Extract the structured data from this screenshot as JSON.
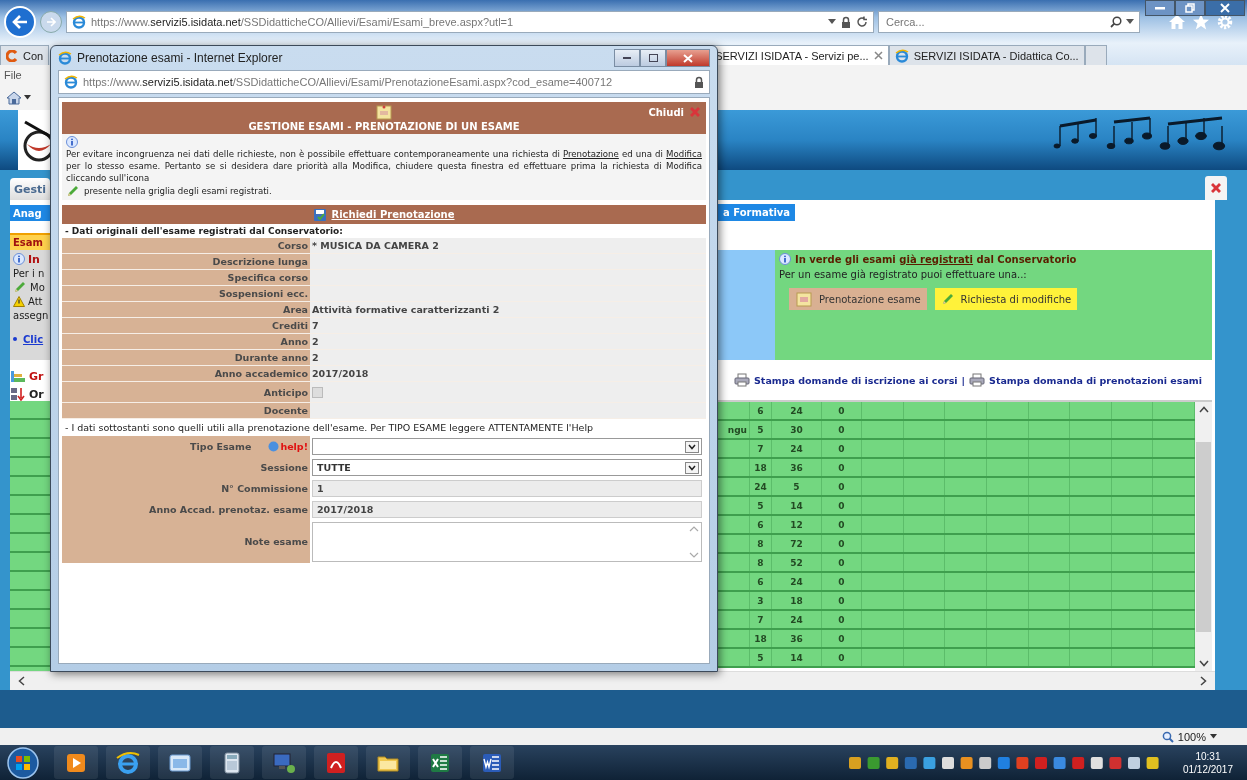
{
  "browser": {
    "address": "https://www.**servizi5.isidata.net**/SSDidatticheCO/Allievi/Esami/Esami_breve.aspx?utl=1",
    "search": {
      "placeholder": "Cerca..."
    },
    "tabs": [
      {
        "label": "Con",
        "selected": false
      },
      {
        "label": "SERVIZI ISIDATA - Servizi pe...",
        "selected": true
      },
      {
        "label": "SERVIZI ISIDATA - Didattica Co...",
        "selected": false
      }
    ],
    "menu": [
      "File"
    ]
  },
  "page": {
    "section_tab": "Gesti",
    "left": {
      "tab": "Anag",
      "exam_tab": "Esam",
      "notice": [
        {
          "kind": "info",
          "text": "In"
        },
        {
          "kind": "plain",
          "text": "Per i n"
        },
        {
          "kind": "pencil",
          "text": "Mo"
        },
        {
          "kind": "warning",
          "text": "Att"
        },
        {
          "kind": "plain",
          "text": "assegn"
        },
        {
          "kind": "bullet",
          "text": "Clic"
        }
      ],
      "tools": [
        {
          "kind": "chart",
          "text": "Gr"
        },
        {
          "kind": "sort",
          "text": "Or"
        }
      ]
    },
    "right": {
      "tab": "a Formativa",
      "info": {
        "title": [
          {
            "text": "In verde gli esami ",
            "underline": false
          },
          {
            "text": "già registrati",
            "underline": true
          },
          {
            "text": " dal Conservatorio",
            "underline": false
          }
        ],
        "subtitle": "Per un esame già registrato puoi effettuare una..:",
        "buttons": [
          {
            "kind": "booking",
            "label": "Prenotazione esame"
          },
          {
            "kind": "edit",
            "label": "Richiesta di modifiche"
          }
        ]
      },
      "print_links": [
        "Stampa domande di iscrizione ai corsi",
        "Stampa domanda di prenotazioni esami"
      ],
      "separator": "|",
      "table": {
        "rows": [
          {
            "column_2": "6",
            "column_3": "24",
            "column_4": "0"
          },
          {
            "column_1": "ngu",
            "column_2": "5",
            "column_3": "30",
            "column_4": "0"
          },
          {
            "column_2": "7",
            "column_3": "24",
            "column_4": "0"
          },
          {
            "column_2": "18",
            "column_3": "36",
            "column_4": "0"
          },
          {
            "column_2": "24",
            "column_3": "5",
            "column_4": "0"
          },
          {
            "column_2": "5",
            "column_3": "14",
            "column_4": "0"
          },
          {
            "column_2": "6",
            "column_3": "12",
            "column_4": "0"
          },
          {
            "column_2": "8",
            "column_3": "72",
            "column_4": "0"
          },
          {
            "column_2": "8",
            "column_3": "52",
            "column_4": "0"
          },
          {
            "column_2": "6",
            "column_3": "24",
            "column_4": "0"
          },
          {
            "column_2": "3",
            "column_3": "18",
            "column_4": "0"
          },
          {
            "column_2": "7",
            "column_3": "24",
            "column_4": "0"
          },
          {
            "column_2": "18",
            "column_3": "36",
            "column_4": "0"
          },
          {
            "column_2": "5",
            "column_3": "14",
            "column_4": "0"
          }
        ]
      }
    }
  },
  "popup": {
    "title": "Prenotazione esami - Internet Explorer",
    "address": "https://www.**servizi5.isidata.net**/SSDidatticheCO/Allievi/Esami/PrenotazioneEsami.aspx?cod_esame=400712",
    "heading": "GESTIONE ESAMI - PRENOTAZIONE DI UN ESAME",
    "close_label": "Chiudi",
    "info": {
      "before": [
        {
          "text": "Per evitare incongruenza nei dati delle richieste, non è possibile effettuare contemporaneamente una richiesta di ",
          "underline": false
        },
        {
          "text": "Prenotazione",
          "underline": true
        },
        {
          "text": " ed una di ",
          "underline": false
        },
        {
          "text": "Modifica",
          "underline": true
        },
        {
          "text": " per lo stesso esame. Pertanto se si desidera dare priorità alla Modifica, chiudere questa finestra ed effettuare prima la richiesta di Modifica cliccando sull'icona",
          "underline": false
        }
      ],
      "after": "presente nella griglia degli esami registrati."
    },
    "request_link": "Richiedi Prenotazione",
    "original_note": "- Dati originali dell'esame registrati dal Conservatorio:",
    "original_rows": [
      {
        "kind": "text",
        "label": "Corso",
        "value": "* MUSICA DA CAMERA 2"
      },
      {
        "kind": "text",
        "label": "Descrizione lunga"
      },
      {
        "kind": "text",
        "label": "Specifica corso"
      },
      {
        "kind": "text",
        "label": "Sospensioni ecc."
      },
      {
        "kind": "text",
        "label": "Area",
        "value": "Attività formative caratterizzanti 2"
      },
      {
        "kind": "text",
        "label": "Crediti",
        "value": "7"
      },
      {
        "kind": "text",
        "label": "Anno",
        "value": "2"
      },
      {
        "kind": "text",
        "label": "Durante anno",
        "value": "2"
      },
      {
        "kind": "text",
        "label": "Anno accademico",
        "value": "2017/2018"
      },
      {
        "kind": "checkbox",
        "label": "Anticipo",
        "checked": false,
        "disabled": true
      },
      {
        "kind": "text",
        "label": "Docente"
      }
    ],
    "booking_note": "- I dati sottostanti sono quelli utili alla prenotazione dell'esame. Per TIPO ESAME leggere ATTENTAMENTE l'Help",
    "fields": [
      {
        "kind": "select",
        "label": "Tipo Esame",
        "help": "help!"
      },
      {
        "kind": "select",
        "label": "Sessione",
        "value": "TUTTE"
      },
      {
        "kind": "readonly",
        "label": "N° Commissione",
        "value": "1"
      },
      {
        "kind": "readonly",
        "label": "Anno Accad. prenotaz. esame",
        "value": "2017/2018"
      },
      {
        "kind": "textarea",
        "label": "Note esame"
      }
    ]
  },
  "status_bar": {
    "zoom": "100%"
  },
  "taskbar": {
    "time": "10:31",
    "date": "01/12/2017"
  }
}
